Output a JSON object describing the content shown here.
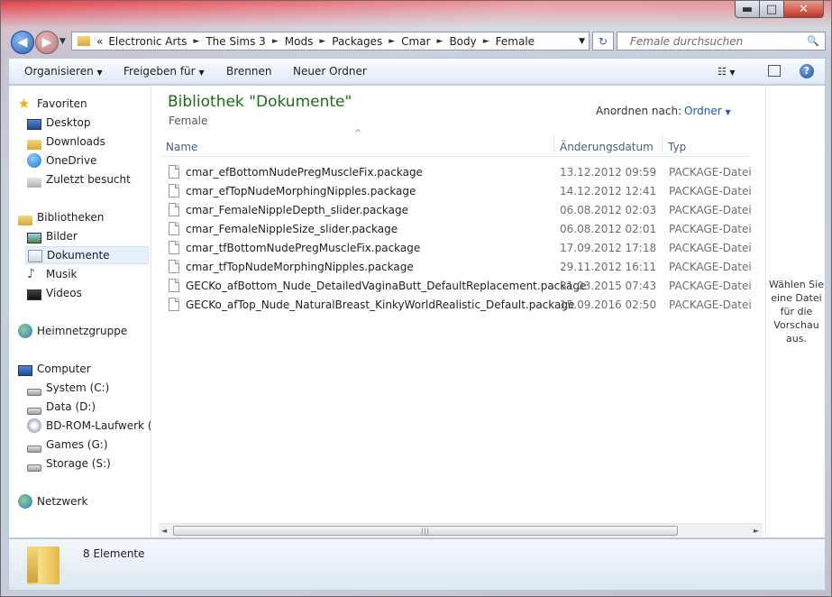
{
  "window": {
    "caption_buttons": {
      "minimize": "▬",
      "maximize": "□",
      "close": "✕"
    }
  },
  "nav": {
    "back_icon": "◀",
    "forward_icon": "▶",
    "recent_icon": "▼",
    "overflow": "«",
    "breadcrumbs": [
      "Electronic Arts",
      "The Sims 3",
      "Mods",
      "Packages",
      "Cmar",
      "Body",
      "Female"
    ],
    "dropdown_icon": "▼",
    "refresh_icon": "↻"
  },
  "search": {
    "placeholder": "Female durchsuchen",
    "icon": "🔍"
  },
  "toolbar": {
    "organize": "Organisieren",
    "share": "Freigeben für",
    "burn": "Brennen",
    "new_folder": "Neuer Ordner",
    "dropdown_glyph": "▼"
  },
  "sidebar": {
    "groups": [
      {
        "label": "Favoriten",
        "items": [
          "Desktop",
          "Downloads",
          "OneDrive",
          "Zuletzt besucht"
        ]
      },
      {
        "label": "Bibliotheken",
        "items": [
          "Bilder",
          "Dokumente",
          "Musik",
          "Videos"
        ]
      },
      {
        "label": "Heimnetzgruppe",
        "items": []
      },
      {
        "label": "Computer",
        "items": [
          "System (C:)",
          "Data (D:)",
          "BD-ROM-Laufwerk (",
          "Games (G:)",
          "Storage (S:)"
        ]
      },
      {
        "label": "Netzwerk",
        "items": []
      }
    ],
    "selected": "Dokumente"
  },
  "main": {
    "library_title": "Bibliothek \"Dokumente\"",
    "library_subtitle": "Female",
    "arrange_label": "Anordnen nach:",
    "arrange_value": "Ordner",
    "columns": [
      "Name",
      "Änderungsdatum",
      "Typ"
    ],
    "sort_indicator": "^",
    "files": [
      {
        "name": "cmar_efBottomNudePregMuscleFix.package",
        "date": "13.12.2012 09:59",
        "type": "PACKAGE-Datei"
      },
      {
        "name": "cmar_efTopNudeMorphingNipples.package",
        "date": "14.12.2012 12:41",
        "type": "PACKAGE-Datei"
      },
      {
        "name": "cmar_FemaleNippleDepth_slider.package",
        "date": "06.08.2012 02:03",
        "type": "PACKAGE-Datei"
      },
      {
        "name": "cmar_FemaleNippleSize_slider.package",
        "date": "06.08.2012 02:01",
        "type": "PACKAGE-Datei"
      },
      {
        "name": "cmar_tfBottomNudePregMuscleFix.package",
        "date": "17.09.2012 17:18",
        "type": "PACKAGE-Datei"
      },
      {
        "name": "cmar_tfTopNudeMorphingNipples.package",
        "date": "29.11.2012 16:11",
        "type": "PACKAGE-Datei"
      },
      {
        "name": "GECKo_afBottom_Nude_DetailedVaginaButt_DefaultReplacement.package",
        "date": "31.03.2015 07:43",
        "type": "PACKAGE-Datei"
      },
      {
        "name": "GECKo_afTop_Nude_NaturalBreast_KinkyWorldRealistic_Default.package",
        "date": "15.09.2016 02:50",
        "type": "PACKAGE-Datei"
      }
    ]
  },
  "preview": {
    "text": "Wählen Sie eine Datei für die Vorschau aus."
  },
  "status": {
    "count": "8 Elemente"
  },
  "colors": {
    "accent_title": "#1e6d19",
    "link_blue": "#1e5ab8",
    "selection": "#e5f0fb"
  }
}
